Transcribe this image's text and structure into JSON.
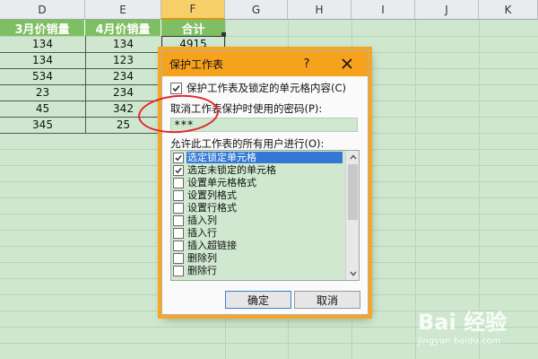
{
  "spreadsheet": {
    "columns": [
      "D",
      "E",
      "F",
      "G",
      "H",
      "I",
      "J",
      "K"
    ],
    "active_column": "F",
    "headers": [
      "3月价销量",
      "4月价销量",
      "合计"
    ],
    "rows": [
      [
        "134",
        "134",
        "4915"
      ],
      [
        "134",
        "123",
        ""
      ],
      [
        "534",
        "234",
        ""
      ],
      [
        "23",
        "234",
        ""
      ],
      [
        "45",
        "342",
        ""
      ],
      [
        "345",
        "25",
        ""
      ]
    ]
  },
  "dialog": {
    "title": "保护工作表",
    "help_label": "?",
    "protect_label": "保护工作表及锁定的单元格内容(C)",
    "protect_checked": true,
    "password_label": "取消工作表保护时使用的密码(P):",
    "password_value": "***",
    "permissions_label": "允许此工作表的所有用户进行(O):",
    "permissions": [
      {
        "label": "选定锁定单元格",
        "checked": true,
        "selected": true
      },
      {
        "label": "选定未锁定的单元格",
        "checked": true,
        "selected": false
      },
      {
        "label": "设置单元格格式",
        "checked": false,
        "selected": false
      },
      {
        "label": "设置列格式",
        "checked": false,
        "selected": false
      },
      {
        "label": "设置行格式",
        "checked": false,
        "selected": false
      },
      {
        "label": "插入列",
        "checked": false,
        "selected": false
      },
      {
        "label": "插入行",
        "checked": false,
        "selected": false
      },
      {
        "label": "插入超链接",
        "checked": false,
        "selected": false
      },
      {
        "label": "删除列",
        "checked": false,
        "selected": false
      },
      {
        "label": "删除行",
        "checked": false,
        "selected": false
      }
    ],
    "ok_label": "确定",
    "cancel_label": "取消"
  },
  "watermark": {
    "main": "Bai 经验",
    "sub": "jingyan.baidu.com"
  },
  "colors": {
    "sheet_bg": "#cfe7cf",
    "header_fill": "#7fbf63",
    "titlebar": "#f7a21c",
    "annotation": "#e0272f",
    "selection": "#3478d4"
  }
}
